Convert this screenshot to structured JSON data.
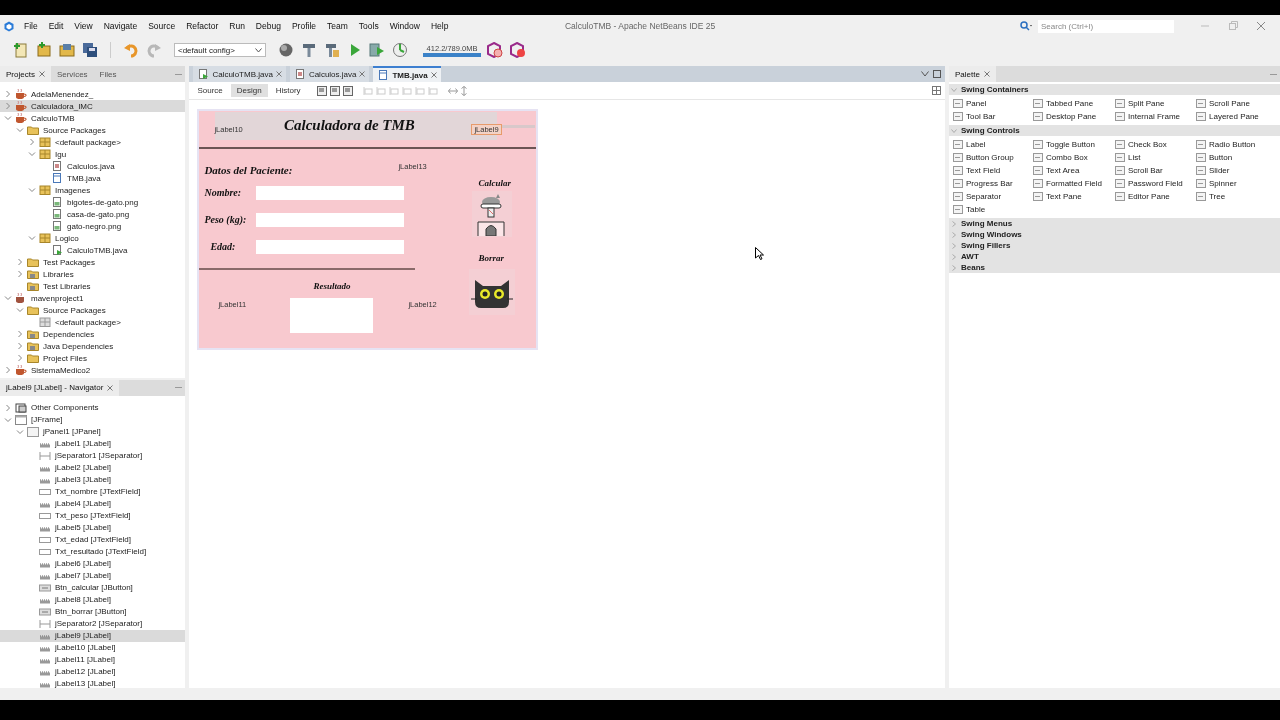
{
  "window": {
    "title": "CalculoTMB - Apache NetBeans IDE 25"
  },
  "menu": [
    "File",
    "Edit",
    "View",
    "Navigate",
    "Source",
    "Refactor",
    "Run",
    "Debug",
    "Profile",
    "Team",
    "Tools",
    "Window",
    "Help"
  ],
  "search": {
    "placeholder": "Search (Ctrl+I)"
  },
  "toolbar": {
    "config": "<default config>",
    "memory": {
      "reading": "412.2/789.0MB",
      "level": 1
    }
  },
  "left_tabs": [
    {
      "label": "Projects",
      "selected": true
    },
    {
      "label": "Services",
      "selected": false
    },
    {
      "label": "Files",
      "selected": false
    }
  ],
  "project_tree": [
    {
      "label": "AdelaMenendez_",
      "kind": "project",
      "expanded": false,
      "selected": false
    },
    {
      "label": "Calculadora_IMC",
      "kind": "project",
      "expanded": false,
      "selected": true
    },
    {
      "label": "CalculoTMB",
      "kind": "project",
      "expanded": true,
      "selected": false,
      "children": [
        {
          "label": "Source Packages",
          "kind": "folder",
          "expanded": true,
          "selected": false,
          "children": [
            {
              "label": "<default package>",
              "kind": "package",
              "expanded": false,
              "selected": false
            },
            {
              "label": "Igu",
              "kind": "package",
              "expanded": true,
              "selected": false,
              "children": [
                {
                  "label": "Calculos.java",
                  "kind": "java",
                  "selected": false
                },
                {
                  "label": "TMB.java",
                  "kind": "form",
                  "selected": false
                }
              ]
            },
            {
              "label": "Imagenes",
              "kind": "package",
              "expanded": true,
              "selected": false,
              "children": [
                {
                  "label": "bigotes-de-gato.png",
                  "kind": "image",
                  "selected": false
                },
                {
                  "label": "casa-de-gato.png",
                  "kind": "image",
                  "selected": false
                },
                {
                  "label": "gato-negro.png",
                  "kind": "image",
                  "selected": false
                }
              ]
            },
            {
              "label": "Logico",
              "kind": "package",
              "expanded": true,
              "selected": false,
              "children": [
                {
                  "label": "CalculoTMB.java",
                  "kind": "main",
                  "selected": false
                }
              ]
            }
          ]
        },
        {
          "label": "Test Packages",
          "kind": "folder",
          "expanded": false,
          "selected": false
        },
        {
          "label": "Libraries",
          "kind": "library",
          "expanded": false,
          "selected": false
        },
        {
          "label": "Test Libraries",
          "kind": "library",
          "selected": false
        }
      ]
    },
    {
      "label": "mavenproject1",
      "kind": "maven",
      "expanded": true,
      "selected": false,
      "children": [
        {
          "label": "Source Packages",
          "kind": "folder",
          "expanded": true,
          "selected": false,
          "children": [
            {
              "label": "<default package>",
              "kind": "empty-package",
              "selected": false
            }
          ]
        },
        {
          "label": "Dependencies",
          "kind": "library",
          "expanded": false,
          "selected": false
        },
        {
          "label": "Java Dependencies",
          "kind": "library",
          "expanded": false,
          "selected": false
        },
        {
          "label": "Project Files",
          "kind": "folder",
          "expanded": false,
          "selected": false
        }
      ]
    },
    {
      "label": "SistemaMedico2",
      "kind": "project",
      "expanded": false,
      "selected": false
    }
  ],
  "navigator": {
    "title": "jLabel9 [JLabel] - Navigator",
    "tree": [
      {
        "label": "Other Components",
        "kind": "other",
        "expanded": false,
        "selected": false
      },
      {
        "label": "[JFrame]",
        "kind": "frame",
        "expanded": true,
        "selected": false,
        "children": [
          {
            "label": "jPanel1 [JPanel]",
            "kind": "panel",
            "expanded": true,
            "selected": false,
            "children": [
              {
                "label": "jLabel1 [JLabel]",
                "kind": "label",
                "selected": false
              },
              {
                "label": "jSeparator1 [JSeparator]",
                "kind": "separator",
                "selected": false
              },
              {
                "label": "jLabel2 [JLabel]",
                "kind": "label",
                "selected": false
              },
              {
                "label": "jLabel3 [JLabel]",
                "kind": "label",
                "selected": false
              },
              {
                "label": "Txt_nombre [JTextField]",
                "kind": "textfield",
                "selected": false
              },
              {
                "label": "jLabel4 [JLabel]",
                "kind": "label",
                "selected": false
              },
              {
                "label": "Txt_peso [JTextField]",
                "kind": "textfield",
                "selected": false
              },
              {
                "label": "jLabel5 [JLabel]",
                "kind": "label",
                "selected": false
              },
              {
                "label": "Txt_edad [JTextField]",
                "kind": "textfield",
                "selected": false
              },
              {
                "label": "Txt_resultado [JTextField]",
                "kind": "textfield",
                "selected": false
              },
              {
                "label": "jLabel6 [JLabel]",
                "kind": "label",
                "selected": false
              },
              {
                "label": "jLabel7 [JLabel]",
                "kind": "label",
                "selected": false
              },
              {
                "label": "Btn_calcular [JButton]",
                "kind": "button",
                "selected": false
              },
              {
                "label": "jLabel8 [JLabel]",
                "kind": "label",
                "selected": false
              },
              {
                "label": "Btn_borrar [JButton]",
                "kind": "button",
                "selected": false
              },
              {
                "label": "jSeparator2 [JSeparator]",
                "kind": "separator",
                "selected": false
              },
              {
                "label": "jLabel9 [JLabel]",
                "kind": "label",
                "selected": true
              },
              {
                "label": "jLabel10 [JLabel]",
                "kind": "label",
                "selected": false
              },
              {
                "label": "jLabel11 [JLabel]",
                "kind": "label",
                "selected": false
              },
              {
                "label": "jLabel12 [JLabel]",
                "kind": "label",
                "selected": false
              },
              {
                "label": "jLabel13 [JLabel]",
                "kind": "label",
                "selected": false
              }
            ]
          }
        ]
      }
    ]
  },
  "editor_tabs": [
    {
      "label": "CalculoTMB.java",
      "kind": "main",
      "selected": false
    },
    {
      "label": "Calculos.java",
      "kind": "java",
      "selected": false
    },
    {
      "label": "TMB.java",
      "kind": "form",
      "selected": true
    }
  ],
  "view_tabs": [
    {
      "label": "Source",
      "selected": false
    },
    {
      "label": "Design",
      "selected": true
    },
    {
      "label": "History",
      "selected": false
    }
  ],
  "form": {
    "title": "Calculadora de TMB",
    "title_left_label": "jLabel10",
    "title_right_label": {
      "text": "jLabel9",
      "selected": true
    },
    "section": "Datos del Paciente:",
    "corner_label": "jLabel13",
    "fields": [
      {
        "label": "Nombre:"
      },
      {
        "label": "Peso (kg):"
      },
      {
        "label": "Edad:"
      }
    ],
    "result_title": "Resultado",
    "result_left_label": "jLabel11",
    "result_right_label": "jLabel12",
    "buttons": [
      {
        "caption": "Calcular",
        "kind": "cat-tower"
      },
      {
        "caption": "Borrar",
        "kind": "cat-face"
      }
    ]
  },
  "palette": {
    "title": "Palette",
    "categories": [
      {
        "name": "Swing Containers",
        "expanded": true,
        "items": [
          "Panel",
          "Tabbed Pane",
          "Split Pane",
          "Scroll Pane",
          "Tool Bar",
          "Desktop Pane",
          "Internal Frame",
          "Layered Pane"
        ]
      },
      {
        "name": "Swing Controls",
        "expanded": true,
        "items": [
          "Label",
          "Toggle Button",
          "Check Box",
          "Radio Button",
          "Button Group",
          "Combo Box",
          "List",
          "Button",
          "Text Field",
          "Text Area",
          "Scroll Bar",
          "Slider",
          "Progress Bar",
          "Formatted Field",
          "Password Field",
          "Spinner",
          "Separator",
          "Text Pane",
          "Editor Pane",
          "Tree",
          "Table"
        ]
      },
      {
        "name": "Swing Menus",
        "expanded": false
      },
      {
        "name": "Swing Windows",
        "expanded": false
      },
      {
        "name": "Swing Fillers",
        "expanded": false
      },
      {
        "name": "AWT",
        "expanded": false
      },
      {
        "name": "Beans",
        "expanded": false
      }
    ]
  }
}
